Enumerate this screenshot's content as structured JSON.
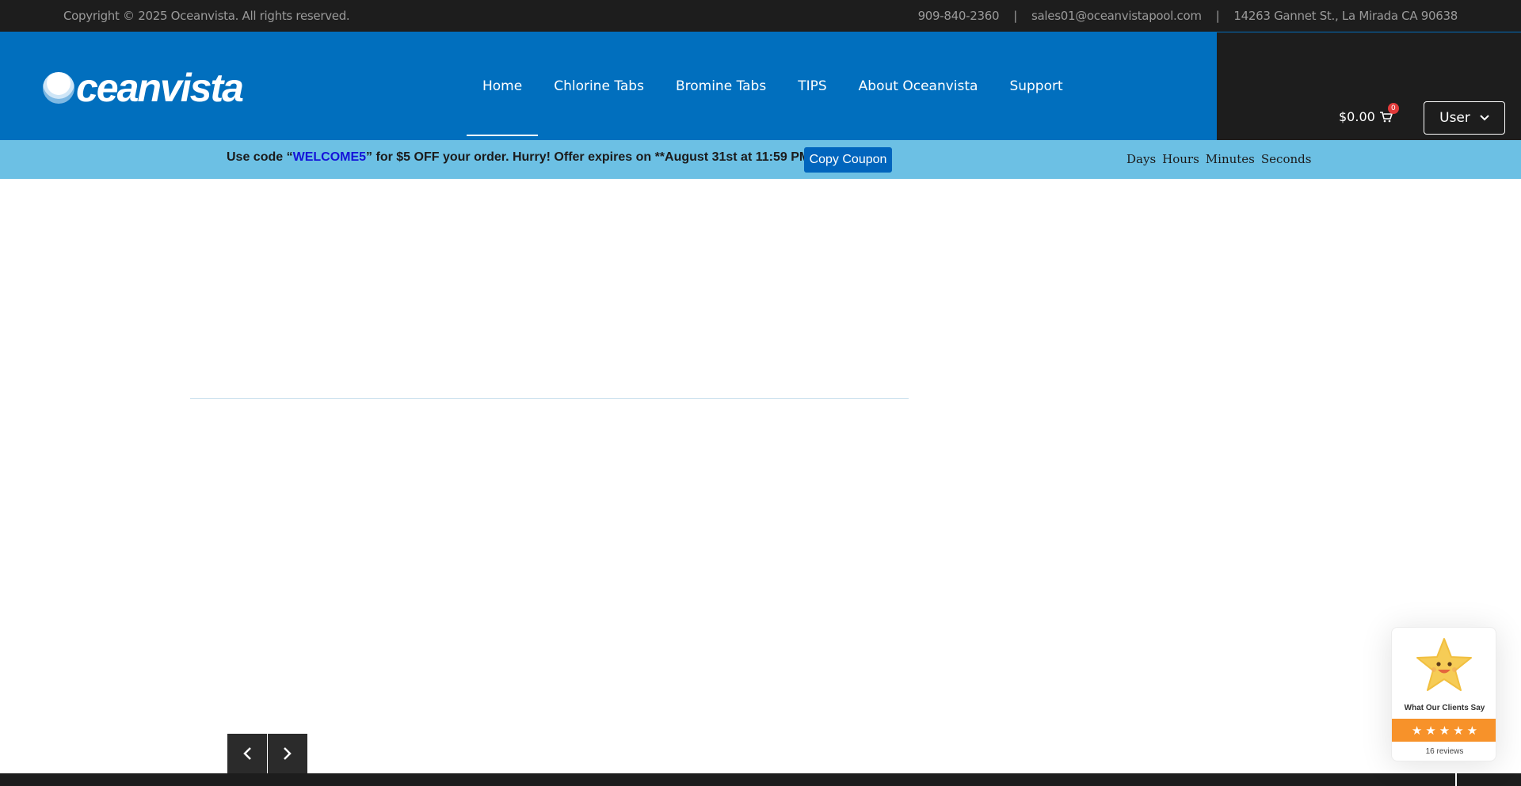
{
  "topbar": {
    "copyright": "Copyright © 2025 Oceanvista. All rights reserved.",
    "phone": "909-840-2360",
    "email": "sales01@oceanvistapool.com",
    "address": "14263 Gannet St., La Mirada CA 90638",
    "separator": "|"
  },
  "header": {
    "logo_text": "ceanvista",
    "nav": [
      {
        "label": "Home",
        "active": true
      },
      {
        "label": "Chlorine Tabs"
      },
      {
        "label": "Bromine Tabs"
      },
      {
        "label": "TIPS"
      },
      {
        "label": "About Oceanvista"
      },
      {
        "label": "Support"
      }
    ],
    "cart_total": "$0.00",
    "cart_count": "0",
    "user_label": "User"
  },
  "promo": {
    "prefix": "Use code “",
    "code": "WELCOME5",
    "suffix": "” for $5 OFF your order. Hurry! Offer expires on **August 31st at 11:59 PM**",
    "copy_button": "Copy Coupon",
    "countdown": [
      "Days",
      "Hours",
      "Minutes",
      "Seconds"
    ]
  },
  "reviews_widget": {
    "title": "What Our Clients Say",
    "rating_stars": 5,
    "count_text": "16 reviews"
  },
  "colors": {
    "brand_blue": "#016fbe",
    "promo_blue": "#6cc0e4",
    "dark": "#1d1d1d",
    "coupon_code": "#1414d9",
    "review_orange": "#f7922a"
  }
}
